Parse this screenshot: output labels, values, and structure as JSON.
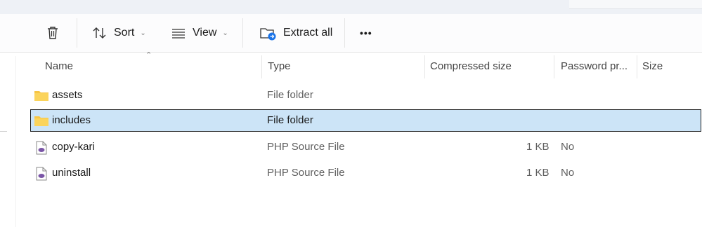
{
  "toolbar": {
    "sort_label": "Sort",
    "view_label": "View",
    "extract_label": "Extract all",
    "more_label": "•••"
  },
  "columns": {
    "name": "Name",
    "type": "Type",
    "compressed": "Compressed size",
    "password": "Password pr...",
    "size": "Size"
  },
  "files": [
    {
      "name": "assets",
      "type": "File folder",
      "compressed": "",
      "password": "",
      "icon": "folder-icon"
    },
    {
      "name": "includes",
      "type": "File folder",
      "compressed": "",
      "password": "",
      "icon": "folder-icon",
      "selected": true
    },
    {
      "name": "copy-kari",
      "type": "PHP Source File",
      "compressed": "1 KB",
      "password": "No",
      "icon": "php-file-icon"
    },
    {
      "name": "uninstall",
      "type": "PHP Source File",
      "compressed": "1 KB",
      "password": "No",
      "icon": "php-file-icon"
    }
  ],
  "colors": {
    "selection": "#cce4f7",
    "folder": "#f7c544",
    "php": "#7a55a6"
  }
}
